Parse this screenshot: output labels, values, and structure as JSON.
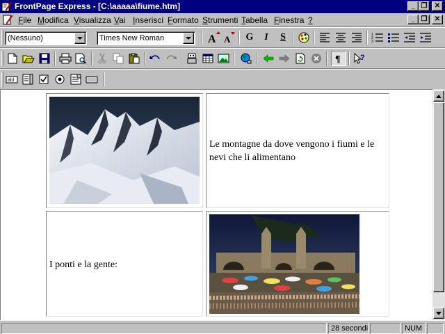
{
  "window": {
    "title": "FrontPage Express - [C:\\aaaaa\\fiume.htm]",
    "caption_buttons": {
      "minimize": "_",
      "restore": "❐",
      "close": "✕"
    }
  },
  "menu": {
    "items": [
      {
        "pre": "",
        "key": "F",
        "post": "ile"
      },
      {
        "pre": "",
        "key": "M",
        "post": "odifica"
      },
      {
        "pre": "",
        "key": "V",
        "post": "isualizza"
      },
      {
        "pre": "",
        "key": "V",
        "post": "ai"
      },
      {
        "pre": "",
        "key": "I",
        "post": "nserisci"
      },
      {
        "pre": "",
        "key": "F",
        "post": "ormato"
      },
      {
        "pre": "",
        "key": "S",
        "post": "trumenti"
      },
      {
        "pre": "",
        "key": "T",
        "post": "abella"
      },
      {
        "pre": "",
        "key": "F",
        "post": "inestra"
      },
      {
        "pre": "",
        "key": "?",
        "post": ""
      }
    ]
  },
  "format_toolbar": {
    "style_value": "(Nessuno)",
    "font_value": "Times New Roman",
    "bold": "G",
    "italic": "I",
    "underline": "S"
  },
  "document": {
    "cell_top_right": "Le montagne da dove vengono i fiumi e le nevi che li alimentano",
    "cell_bottom_left": "I ponti e la gente:"
  },
  "status": {
    "time": "28 secondi",
    "num": "NUM"
  },
  "colors": {
    "titlebar": "#000080",
    "face": "#c0c0c0"
  }
}
